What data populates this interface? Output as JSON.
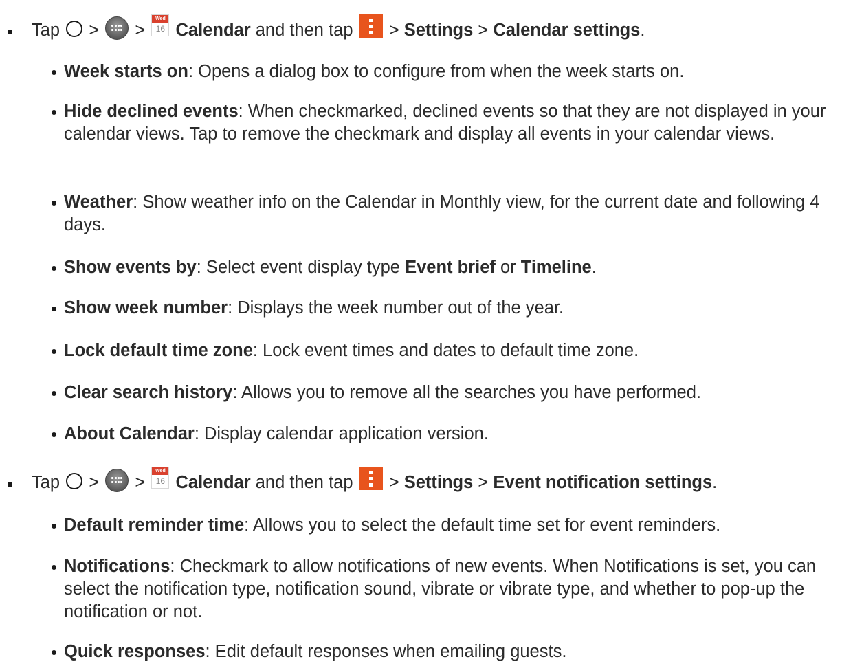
{
  "sections": [
    {
      "step": {
        "tap": "Tap",
        "sep": ">",
        "calendar_icon": {
          "month": "Wed",
          "day": "16"
        },
        "app_label": "Calendar",
        "and_then_tap": "and then tap",
        "menu1": "Settings",
        "menu2": "Calendar settings",
        "end": "."
      },
      "items": [
        {
          "term": "Week starts on",
          "desc": ": Opens a dialog box to configure from when the week starts on."
        },
        {
          "term": "Hide declined events",
          "desc": ": When checkmarked, declined events so that they are not displayed in your calendar views. Tap to remove the checkmark and display all events in your calendar views."
        },
        {
          "term": "Weather",
          "desc": ": Show weather info on the Calendar in Monthly view, for the current date and following 4 days."
        },
        {
          "term": "Show events by",
          "desc": ": Select event display type ",
          "opt1": "Event brief",
          "or": " or ",
          "opt2": "Timeline",
          "end": "."
        },
        {
          "term": "Show week number",
          "desc": ": Displays the week number out of the year."
        },
        {
          "term": "Lock default time zone",
          "desc": ": Lock event times and dates to default time zone."
        },
        {
          "term": "Clear search history",
          "desc": ": Allows you to remove all the searches you have performed."
        },
        {
          "term": "About Calendar",
          "desc": ": Display calendar application version."
        }
      ]
    },
    {
      "step": {
        "tap": "Tap",
        "sep": ">",
        "calendar_icon": {
          "month": "Wed",
          "day": "16"
        },
        "app_label": "Calendar",
        "and_then_tap": "and then tap",
        "menu1": "Settings",
        "menu2": "Event notification settings",
        "end": "."
      },
      "items": [
        {
          "term": "Default reminder time",
          "desc": ": Allows you to select the default time set for event reminders."
        },
        {
          "term": "Notifications",
          "desc": ": Checkmark to allow notifications of new events. When Notifications is set, you can select the notification type, notification sound, vibrate or vibrate type, and whether to pop-up the notification or not."
        },
        {
          "term": "Quick responses",
          "desc": ": Edit default responses when emailing guests."
        }
      ]
    }
  ],
  "icons": {
    "home": "home-circle-icon",
    "apps": "apps-grid-icon",
    "calendar": "calendar-icon",
    "menu": "menu-more-icon"
  },
  "colors": {
    "menu_icon": "#e8541d",
    "calendar_header": "#d9412e",
    "text": "#2b2b2b"
  }
}
